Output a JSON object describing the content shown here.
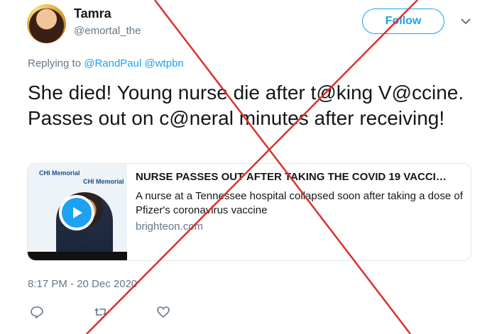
{
  "author": {
    "display_name": "Tamra",
    "handle": "@emortal_the"
  },
  "follow_label": "Follow",
  "reply": {
    "prefix": "Replying to",
    "mentions": "@RandPaul @wtpbn"
  },
  "tweet_text": "She died! Young nurse die after t@king V@ccine. Passes out on c@neral minutes after receiving!",
  "card": {
    "title": "NURSE PASSES OUT AFTER TAKING THE COVID 19 VACCI…",
    "description": "A nurse at a Tennessee hospital collapsed soon after taking a dose of Pfizer's coronavirus vaccine",
    "domain": "brighteon.com",
    "thumb_logo": "CHI Memorial"
  },
  "timestamp": "8:17 PM - 20 Dec 2020",
  "actions": [
    "reply-icon",
    "retweet-icon",
    "like-icon"
  ],
  "colors": {
    "accent": "#1da1f2",
    "muted": "#657786",
    "cross": "#d9322b"
  }
}
